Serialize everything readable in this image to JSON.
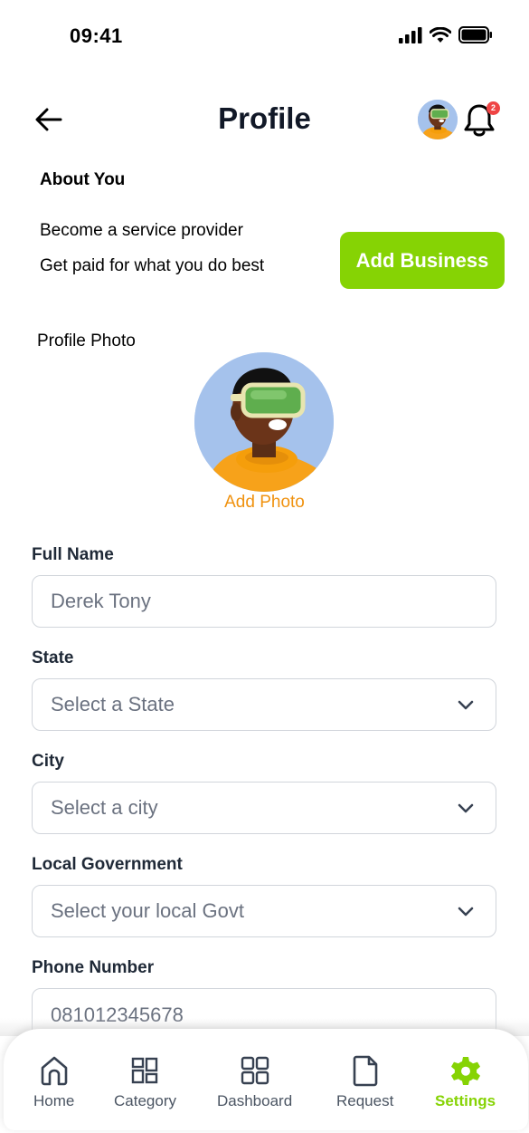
{
  "status_bar": {
    "time": "09:41"
  },
  "header": {
    "title": "Profile",
    "notification_count": "2"
  },
  "about": {
    "heading": "About You",
    "provider_title": "Become a service provider",
    "provider_subtitle": "Get paid for what you do best",
    "add_business_label": "Add Business"
  },
  "photo": {
    "label": "Profile Photo",
    "add_photo_label": "Add Photo"
  },
  "form": {
    "full_name": {
      "label": "Full Name",
      "value": "Derek Tony"
    },
    "state": {
      "label": "State",
      "value": "Select a State"
    },
    "city": {
      "label": "City",
      "value": "Select a city"
    },
    "local_government": {
      "label": "Local Government",
      "value": "Select your local Govt"
    },
    "phone": {
      "label": "Phone Number",
      "value": "081012345678"
    }
  },
  "nav": {
    "items": [
      {
        "label": "Home",
        "icon": "home-icon"
      },
      {
        "label": "Category",
        "icon": "category-icon"
      },
      {
        "label": "Dashboard",
        "icon": "dashboard-icon"
      },
      {
        "label": "Request",
        "icon": "document-icon"
      },
      {
        "label": "Settings",
        "icon": "gear-icon"
      }
    ],
    "active_color": "#86d304"
  },
  "colors": {
    "accent": "#86d304",
    "photo_link": "#f0920f",
    "badge": "#ef4444"
  }
}
